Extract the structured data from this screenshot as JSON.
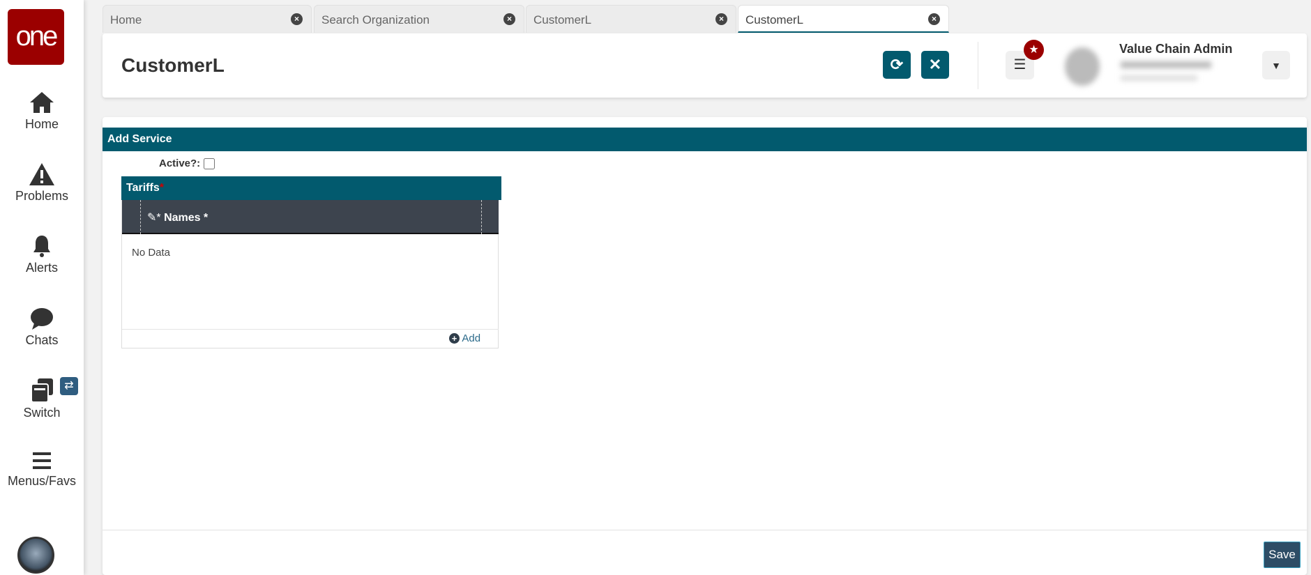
{
  "sidebar": {
    "logo": "one",
    "items": [
      {
        "label": "Home"
      },
      {
        "label": "Problems"
      },
      {
        "label": "Alerts"
      },
      {
        "label": "Chats"
      },
      {
        "label": "Switch"
      },
      {
        "label": "Menus/Favs"
      }
    ]
  },
  "tabs": [
    {
      "label": "Home"
    },
    {
      "label": "Search Organization"
    },
    {
      "label": "CustomerL"
    },
    {
      "label": "CustomerL",
      "active": true
    }
  ],
  "header": {
    "title": "CustomerL",
    "user_role": "Value Chain Admin"
  },
  "form": {
    "section_title": "Add Service",
    "active_label": "Active?:",
    "active_checked": false,
    "tariffs": {
      "title": "Tariffs",
      "required_mark": "*",
      "column": "Names *",
      "empty_text": "No Data",
      "add_label": "Add"
    }
  },
  "footer": {
    "save_label": "Save"
  },
  "colors": {
    "brand": "#9b0000",
    "accent": "#025a6e",
    "grid_header": "#3d444e"
  }
}
